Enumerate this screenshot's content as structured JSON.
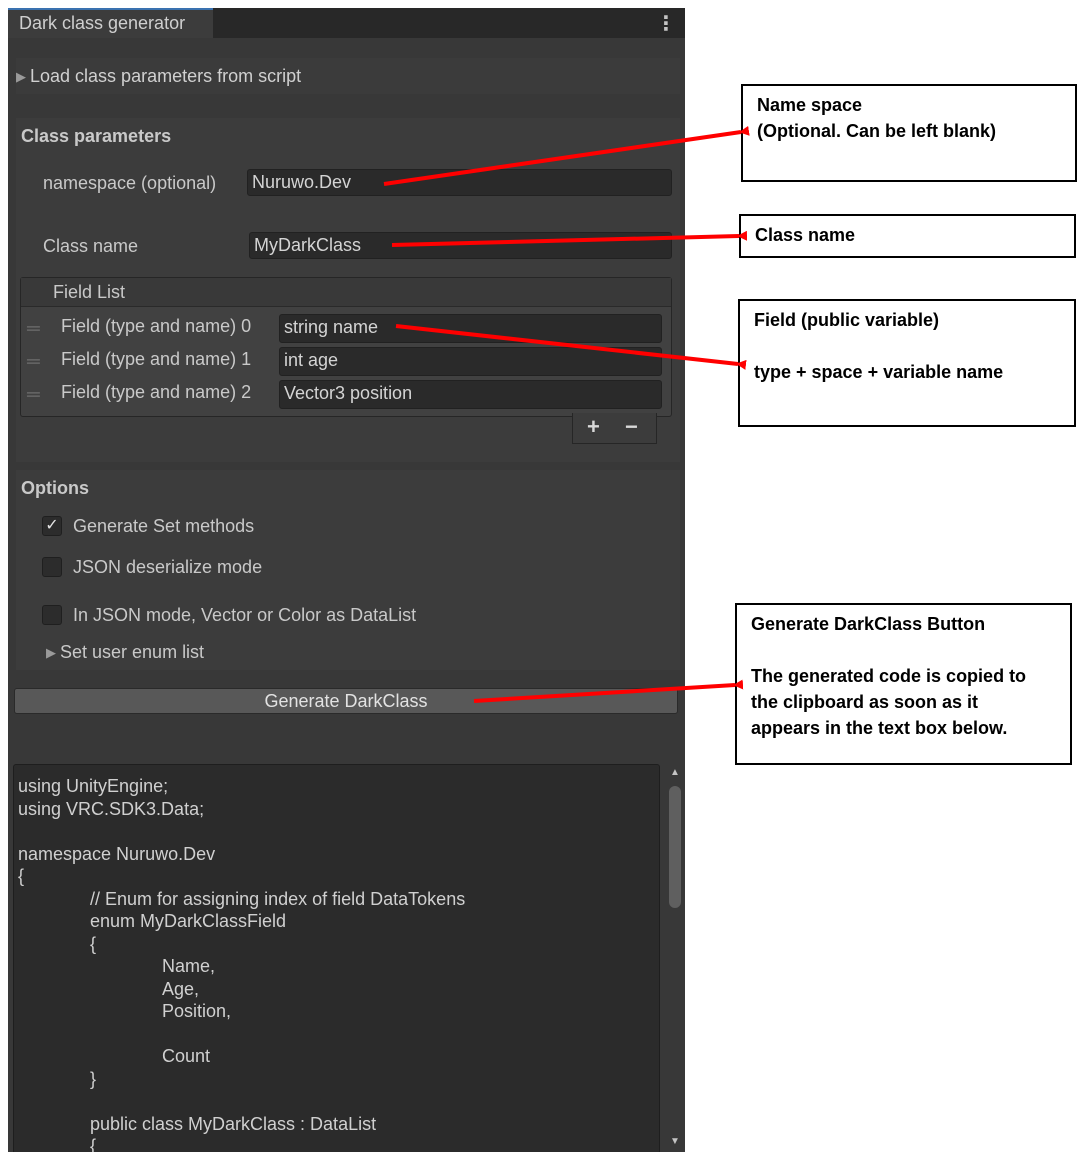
{
  "window": {
    "tab_title": "Dark class generator"
  },
  "load_section": {
    "label": "Load class parameters from script"
  },
  "class_parameters": {
    "header": "Class parameters",
    "namespace_label": "namespace (optional)",
    "namespace_value": "Nuruwo.Dev",
    "classname_label": "Class name",
    "classname_value": "MyDarkClass",
    "field_list": {
      "header": "Field List",
      "items": [
        {
          "label": "Field (type and name) 0",
          "value": "string name"
        },
        {
          "label": "Field (type and name) 1",
          "value": "int age"
        },
        {
          "label": "Field (type and name) 2",
          "value": "Vector3 position"
        }
      ],
      "add_label": "+",
      "remove_label": "−"
    }
  },
  "options": {
    "header": "Options",
    "generate_set_methods": {
      "label": "Generate Set methods",
      "checked": true
    },
    "json_deserialize": {
      "label": "JSON deserialize mode",
      "checked": false
    },
    "json_datalist": {
      "label": "In JSON mode, Vector or Color as DataList",
      "checked": false
    },
    "user_enum_label": "Set user enum list"
  },
  "generate_button": {
    "label": "Generate DarkClass"
  },
  "code_output": {
    "lines": [
      "using UnityEngine;",
      "using VRC.SDK3.Data;",
      "",
      "namespace Nuruwo.Dev",
      "{",
      "\t// Enum for assigning index of field DataTokens",
      "\tenum MyDarkClassField",
      "\t{",
      "\t\tName,",
      "\t\tAge,",
      "\t\tPosition,",
      "",
      "\t\tCount",
      "\t}",
      "",
      "\tpublic class MyDarkClass : DataList",
      "\t{"
    ]
  },
  "annotations": {
    "namespace": {
      "lines": [
        "Name space",
        "(Optional. Can be left blank)"
      ]
    },
    "classname": {
      "lines": [
        "Class name"
      ]
    },
    "field": {
      "lines": [
        "Field (public variable)",
        "",
        "type + space + variable name"
      ]
    },
    "generate": {
      "lines": [
        "Generate DarkClass Button",
        "",
        "The generated code is copied to",
        "the clipboard as soon as it",
        "appears in the text box below."
      ]
    }
  },
  "colors": {
    "panel_bg": "#383838",
    "field_bg": "#2a2a2a",
    "arrow_red": "#ff0000",
    "accent_tab": "#3a72b0"
  },
  "icons": {
    "foldout": "triangle-right-icon",
    "kebab": "kebab-menu-icon",
    "drag": "drag-handle-icon",
    "check": "checkmark-icon"
  }
}
